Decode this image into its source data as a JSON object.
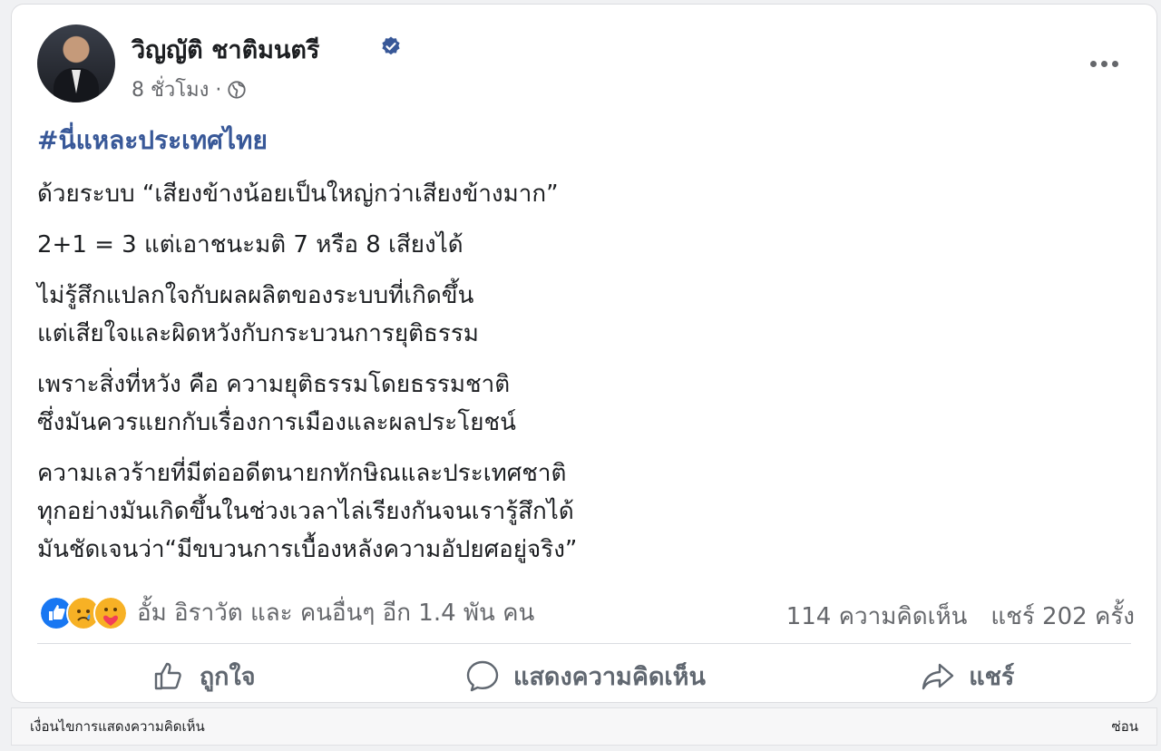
{
  "post": {
    "author": "วิญญัติ ชาติมนตรี",
    "time": "8 ชั่วโมง ·",
    "hashtag": "#นี่แหละประเทศไทย",
    "lines": [
      [
        "ด้วยระบบ “เสียงข้างน้อยเป็นใหญ่กว่าเสียงข้างมาก”"
      ],
      [
        "2+1 = 3  แต่เอาชนะมติ 7 หรือ 8 เสียงได้"
      ],
      [
        "ไม่รู้สึกแปลกใจกับผลผลิตของระบบที่เกิดขึ้น",
        "แต่เสียใจและผิดหวังกับกระบวนการยุติธรรม"
      ],
      [
        "เพราะสิ่งที่หวัง คือ ความยุติธรรมโดยธรรมชาติ",
        "ซึ่งมันควรแยกกับเรื่องการเมืองและผลประโยชน์"
      ],
      [
        "ความเลวร้ายที่มีต่ออดีตนายกทักษิณและประเทศชาติ",
        "ทุกอย่างมันเกิดขึ้นในช่วงเวลาไล่เรียงกันจนเรารู้สึกได้",
        "มันชัดเจนว่า“มีขบวนการเบื้องหลังความอัปยศอยู่จริง”"
      ]
    ],
    "reactions_text": "อั้ม อิราวัต และ คนอื่นๆ อีก 1.4 พัน คน",
    "comments_count": "114 ความคิดเห็น",
    "shares_count": "แชร์ 202 ครั้ง",
    "reaction_icons": [
      "like-icon",
      "sad-icon",
      "care-icon"
    ]
  },
  "actions": {
    "like": "ถูกใจ",
    "comment": "แสดงความคิดเห็น",
    "share": "แชร์"
  },
  "comment_bar": {
    "label": "เงื่อนไขการแสดงความคิดเห็น",
    "hide": "ซ่อน"
  },
  "colors": {
    "hashtag": "#385898",
    "verified": "#385898",
    "muted": "#65676b"
  }
}
